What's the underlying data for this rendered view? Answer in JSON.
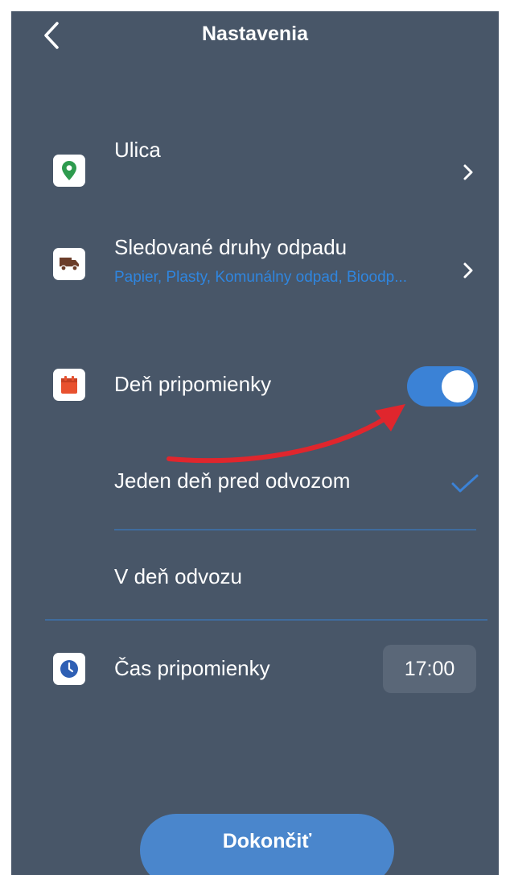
{
  "header": {
    "title": "Nastavenia"
  },
  "street": {
    "label": "Ulica",
    "value": "",
    "icon": "location-pin-icon"
  },
  "waste_types": {
    "label": "Sledované druhy odpadu",
    "subtitle": "Papier, Plasty, Komunálny odpad, Bioodp...",
    "icon": "truck-icon"
  },
  "reminder_day": {
    "label": "Deň pripomienky",
    "enabled": true,
    "icon": "calendar-icon",
    "options": [
      {
        "label": "Jeden deň pred odvozom",
        "selected": true
      },
      {
        "label": "V deň odvozu",
        "selected": false
      }
    ]
  },
  "reminder_time": {
    "label": "Čas pripomienky",
    "value": "17:00",
    "icon": "clock-icon"
  },
  "footer": {
    "done_label": "Dokončiť"
  },
  "colors": {
    "background": "#485668",
    "accent": "#3b82d6",
    "link_text": "#2f86e0",
    "annotation_arrow": "#e0262d",
    "location_icon": "#2e9b4e",
    "truck_icon": "#6b3d2a",
    "calendar_icon": "#e8512f",
    "clock_icon": "#2e5fb4"
  }
}
